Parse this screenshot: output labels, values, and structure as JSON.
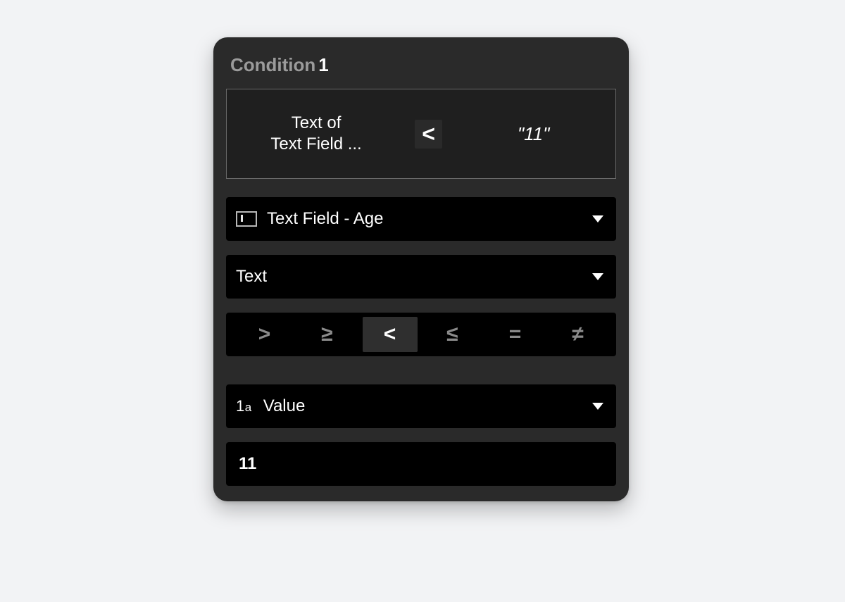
{
  "header": {
    "label": "Condition",
    "index": "1"
  },
  "preview": {
    "left_line1": "Text of",
    "left_line2": "Text Field ...",
    "operator": "<",
    "right": "\"11\""
  },
  "source_dropdown": {
    "icon": "text-field-icon",
    "label": "Text Field - Age"
  },
  "property_dropdown": {
    "label": "Text"
  },
  "operators": {
    "options": [
      {
        "symbol": ">",
        "name": "greater-than"
      },
      {
        "symbol": "≥",
        "name": "greater-or-equal"
      },
      {
        "symbol": "<",
        "name": "less-than"
      },
      {
        "symbol": "≤",
        "name": "less-or-equal"
      },
      {
        "symbol": "=",
        "name": "equal"
      },
      {
        "symbol": "≠",
        "name": "not-equal"
      }
    ],
    "selected_index": 2
  },
  "value_type_dropdown": {
    "badge": "1a",
    "label": "Value"
  },
  "value_input": {
    "value": "11"
  }
}
